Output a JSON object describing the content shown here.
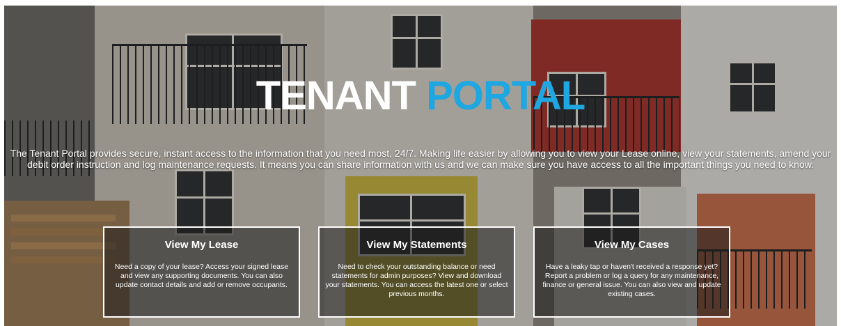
{
  "hero": {
    "title_part1": "TENANT ",
    "title_part2": "PORTAL",
    "intro": "The Tenant Portal provides secure, instant access to the information that you need most, 24/7. Making life easier by allowing you to view your Lease online, view your statements, amend your debit order instruction and log maintenance requests. It means you can share information with us and we can make sure you have access to all the important things you need to know."
  },
  "cards": [
    {
      "title": "View My Lease",
      "text": "Need a copy of your lease? Access your signed lease and view any supporting documents. You can also update contact details and add or remove occupants."
    },
    {
      "title": "View My Statements",
      "text": "Need to check your outstanding balance or need statements for admin purposes? View and download your statements. You can access the latest one or select previous months."
    },
    {
      "title": "View My Cases",
      "text": "Have a leaky tap or haven't received a response yet? Report a problem or log a query for any maintenance, finance or general issue. You can also view and update existing cases."
    }
  ],
  "colors": {
    "accent": "#1ea7e0",
    "title_white": "#ffffff"
  }
}
